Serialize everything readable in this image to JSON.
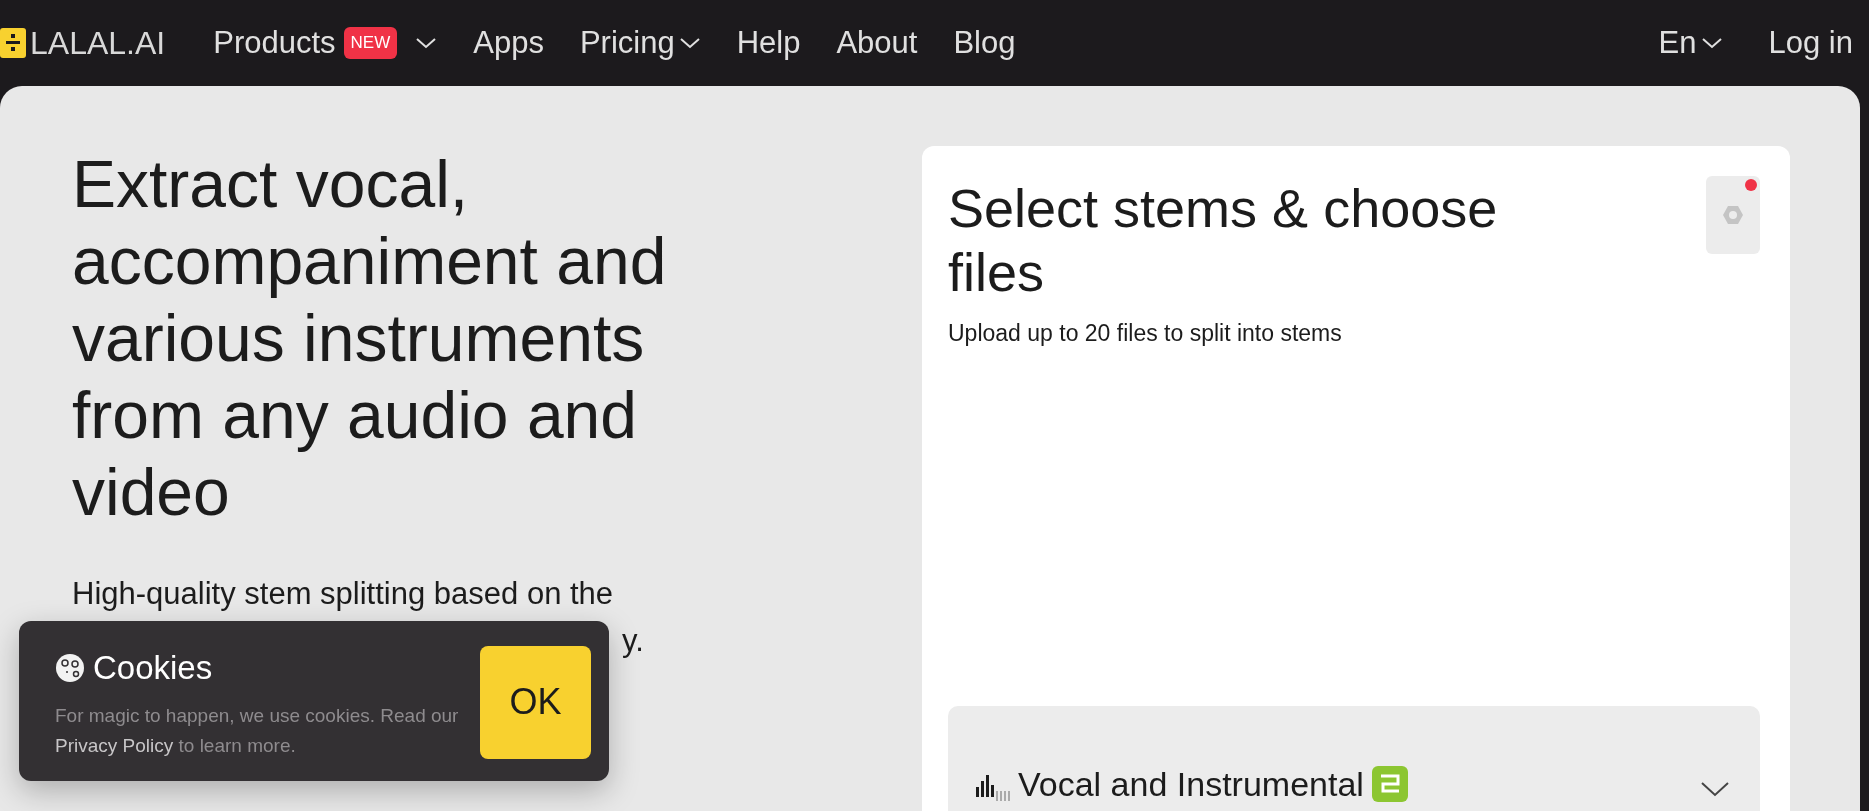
{
  "nav": {
    "logo": "LALAL.AI",
    "items": [
      {
        "label": "Products",
        "badge": "NEW",
        "dropdown": true
      },
      {
        "label": "Apps",
        "dropdown": false
      },
      {
        "label": "Pricing",
        "dropdown": true
      },
      {
        "label": "Help",
        "dropdown": false
      },
      {
        "label": "About",
        "dropdown": false
      },
      {
        "label": "Blog",
        "dropdown": false
      }
    ],
    "language": "En",
    "login": "Log in"
  },
  "hero": {
    "title": "Extract vocal, accompaniment and various instruments from any audio and video",
    "subtitle": "High-quality stem splitting based on the",
    "subtitle_tail": "y."
  },
  "upload_card": {
    "title": "Select stems & choose files",
    "subtitle": "Upload up to 20 files to split into stems",
    "settings_notification": true,
    "stem_selector": {
      "label": "Vocal and Instrumental"
    }
  },
  "cookie_banner": {
    "title": "Cookies",
    "text_before": "For magic to happen, we use cookies. Read our ",
    "link": "Privacy Policy",
    "text_after": " to learn more.",
    "button": "OK"
  }
}
